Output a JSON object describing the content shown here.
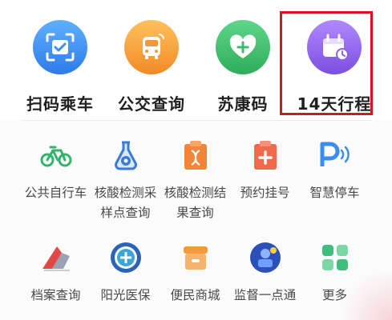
{
  "top_row": [
    {
      "label": "扫码乘车",
      "icon": "scan-qr-icon",
      "color": "#3d8ff0"
    },
    {
      "label": "公交查询",
      "icon": "bus-icon",
      "color": "#f39a36"
    },
    {
      "label": "苏康码",
      "icon": "health-code-heart-icon",
      "color": "#3dbd67"
    },
    {
      "label": "14天行程",
      "icon": "calendar-clock-icon",
      "color": "#8a63e8"
    }
  ],
  "services_row1": [
    {
      "label": "公共自行车",
      "icon": "bicycle-icon",
      "color": "#34b36b"
    },
    {
      "label": "核酸检测采\n样点查询",
      "icon": "flask-icon",
      "color": "#3a7bd5"
    },
    {
      "label": "核酸检测结\n果查询",
      "icon": "dna-clipboard-icon",
      "color": "#f0822e"
    },
    {
      "label": "预约挂号",
      "icon": "medical-cross-icon",
      "color": "#f06a4a"
    },
    {
      "label": "智慧停车",
      "icon": "parking-icon",
      "color": "#3a8ef0"
    }
  ],
  "services_row2": [
    {
      "label": "档案查询",
      "icon": "archive-logo-icon",
      "color": "#e04848"
    },
    {
      "label": "阳光医保",
      "icon": "medical-insurance-seal-icon",
      "color": "#2a63b8"
    },
    {
      "label": "便民商城",
      "icon": "store-icon",
      "color": "#f59a3c"
    },
    {
      "label": "监督一点通",
      "icon": "supervision-icon",
      "color": "#2c4fb8"
    },
    {
      "label": "更多",
      "icon": "more-grid-icon",
      "color": "#3dbf7e"
    }
  ],
  "highlight_color": "#d8141b"
}
